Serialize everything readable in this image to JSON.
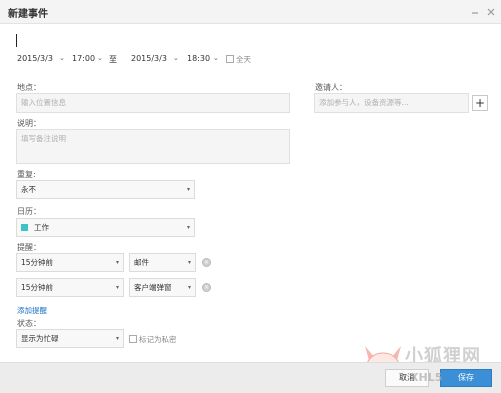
{
  "window": {
    "title": "新建事件"
  },
  "start": {
    "date": "2015/3/3",
    "time": "17:00"
  },
  "separator": "至",
  "end": {
    "date": "2015/3/3",
    "time": "18:30"
  },
  "all_day": {
    "label": "全天",
    "checked": false
  },
  "location": {
    "label": "地点：",
    "placeholder": "输入位置信息"
  },
  "description": {
    "label": "说明：",
    "placeholder": "填写备注说明"
  },
  "invitees": {
    "label": "邀请人：",
    "placeholder": "添加参与人，设备资源等..."
  },
  "repeat": {
    "label": "重复:",
    "value": "永不"
  },
  "calendar": {
    "label": "日历：",
    "value": "工作",
    "color": "#3bc3c8"
  },
  "reminders": {
    "label": "提醒：",
    "items": [
      {
        "time": "15分钟前",
        "method": "邮件"
      },
      {
        "time": "15分钟前",
        "method": "客户端弹窗"
      }
    ],
    "add_label": "添加提醒"
  },
  "status": {
    "label": "状态：",
    "value": "显示为忙碌",
    "private_label": "标记为私密",
    "private_checked": false
  },
  "footer": {
    "cancel_label": "取消",
    "save_label": "保存"
  },
  "watermark": {
    "text": "小狐狸网",
    "subtext": "XHL5"
  }
}
